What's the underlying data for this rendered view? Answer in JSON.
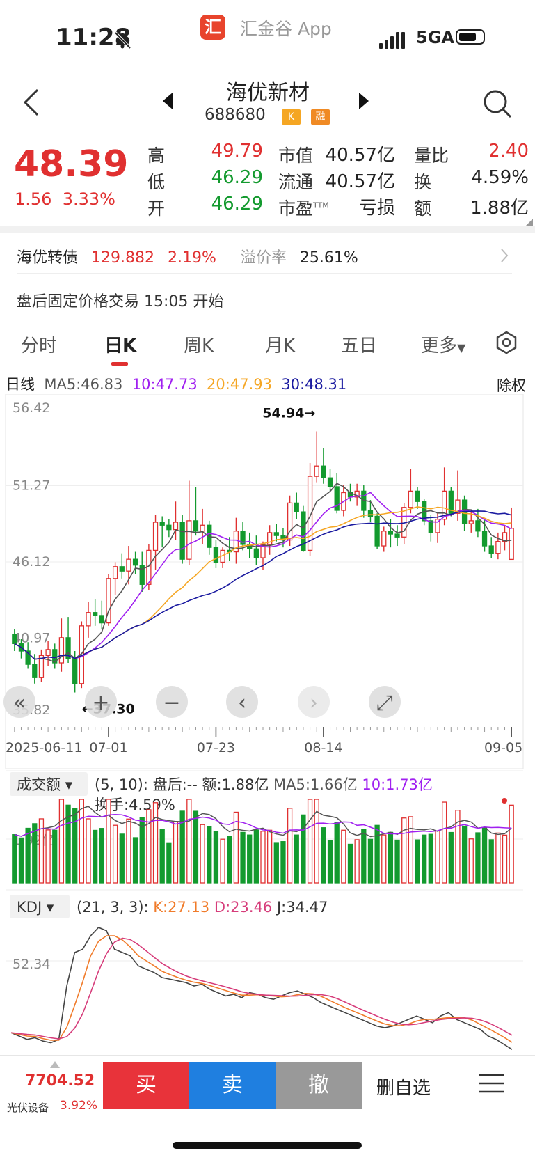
{
  "status": {
    "time": "11:28",
    "app_name": "汇金谷 App",
    "app_logo": "汇",
    "network": "5GA"
  },
  "header": {
    "name": "海优新材",
    "code": "688680",
    "tag_k": "K",
    "tag_rong": "融"
  },
  "quote": {
    "price": "48.39",
    "change": "1.56",
    "change_pct": "3.33%",
    "fields": [
      {
        "label": "高",
        "value": "49.79",
        "color": "red"
      },
      {
        "label": "低",
        "value": "46.29",
        "color": "green"
      },
      {
        "label": "开",
        "value": "46.29",
        "color": "green"
      },
      {
        "label": "市值",
        "value": "40.57亿",
        "color": "dark"
      },
      {
        "label": "流通",
        "value": "40.57亿",
        "color": "dark"
      },
      {
        "label": "市盈",
        "sup": "TTM",
        "value": "亏损",
        "color": "dark"
      },
      {
        "label": "量比",
        "value": "2.40",
        "color": "red"
      },
      {
        "label": "换",
        "value": "4.59%",
        "color": "dark"
      },
      {
        "label": "额",
        "value": "1.88亿",
        "color": "dark"
      }
    ]
  },
  "bond": {
    "name": "海优转债",
    "price": "129.882",
    "pct": "2.19%",
    "premium_label": "溢价率",
    "premium": "25.61%"
  },
  "after_hours": "盘后固定价格交易 15:05 开始",
  "tabs": [
    "分时",
    "日K",
    "周K",
    "月K",
    "五日",
    "更多"
  ],
  "ma": {
    "label": "日线",
    "ma5": "MA5:46.83",
    "ma10": "10:47.73",
    "ma20": "20:47.93",
    "ma30": "30:48.31",
    "adjust": "除权"
  },
  "colors": {
    "up": "#e03030",
    "down": "#139a2e",
    "ma5": "#555555",
    "ma10": "#a020f0",
    "ma20": "#f5a623",
    "ma30": "#1a1aa0"
  },
  "chart_data": [
    {
      "type": "candlestick",
      "title": "日K",
      "y_ticks": [
        "56.42",
        "51.27",
        "46.12",
        "40.97",
        "35.82"
      ],
      "ylim": [
        35.82,
        56.42
      ],
      "x_ticks": [
        "2025-06-11",
        "07-01",
        "07-23",
        "08-14",
        "09-05"
      ],
      "max_label": "54.94→",
      "min_label": "←37.30",
      "ohlc": [
        [
          41.2,
          41.6,
          40.1,
          40.6
        ],
        [
          40.6,
          40.9,
          39.6,
          40.1
        ],
        [
          40.1,
          40.7,
          38.9,
          39.2
        ],
        [
          39.2,
          39.9,
          37.9,
          38.3
        ],
        [
          38.3,
          40.2,
          38.0,
          39.8
        ],
        [
          39.8,
          40.8,
          39.1,
          40.2
        ],
        [
          40.2,
          40.6,
          38.9,
          39.3
        ],
        [
          39.3,
          42.3,
          38.7,
          41.0
        ],
        [
          41.0,
          42.4,
          39.3,
          39.6
        ],
        [
          39.6,
          40.1,
          37.3,
          37.9
        ],
        [
          37.9,
          42.1,
          37.6,
          41.8
        ],
        [
          41.8,
          43.4,
          41.0,
          42.7
        ],
        [
          42.7,
          43.6,
          41.8,
          42.5
        ],
        [
          42.5,
          43.5,
          41.6,
          42.0
        ],
        [
          42.0,
          45.3,
          41.8,
          45.0
        ],
        [
          45.0,
          46.1,
          43.9,
          45.8
        ],
        [
          45.8,
          46.7,
          45.0,
          45.5
        ],
        [
          45.5,
          47.2,
          44.6,
          46.3
        ],
        [
          46.3,
          46.8,
          45.3,
          45.9
        ],
        [
          45.9,
          46.8,
          44.1,
          44.6
        ],
        [
          44.6,
          47.3,
          44.2,
          46.9
        ],
        [
          46.9,
          49.3,
          45.6,
          48.8
        ],
        [
          48.8,
          49.2,
          47.1,
          48.6
        ],
        [
          48.6,
          49.0,
          47.8,
          48.3
        ],
        [
          48.3,
          50.2,
          47.6,
          48.8
        ],
        [
          48.8,
          49.3,
          46.0,
          46.3
        ],
        [
          46.3,
          51.6,
          45.9,
          48.9
        ],
        [
          48.9,
          51.2,
          47.9,
          48.2
        ],
        [
          48.2,
          49.7,
          47.3,
          48.6
        ],
        [
          48.6,
          48.9,
          46.6,
          47.1
        ],
        [
          47.1,
          47.6,
          45.7,
          46.1
        ],
        [
          46.1,
          47.1,
          45.7,
          46.9
        ],
        [
          46.9,
          47.8,
          46.2,
          46.8
        ],
        [
          46.8,
          49.1,
          46.0,
          48.2
        ],
        [
          48.2,
          48.8,
          46.9,
          47.3
        ],
        [
          47.3,
          48.1,
          46.4,
          47.0
        ],
        [
          47.0,
          47.9,
          45.9,
          46.4
        ],
        [
          46.4,
          47.5,
          45.6,
          47.3
        ],
        [
          47.3,
          48.6,
          46.6,
          48.1
        ],
        [
          48.1,
          48.7,
          47.5,
          47.9
        ],
        [
          47.9,
          48.4,
          47.1,
          47.6
        ],
        [
          47.6,
          50.6,
          47.2,
          50.1
        ],
        [
          50.1,
          50.8,
          49.0,
          49.5
        ],
        [
          49.5,
          49.9,
          46.8,
          46.9
        ],
        [
          46.9,
          52.8,
          46.5,
          51.9
        ],
        [
          51.9,
          54.94,
          51.5,
          52.6
        ],
        [
          52.6,
          53.8,
          51.4,
          51.8
        ],
        [
          51.8,
          52.4,
          50.9,
          51.2
        ],
        [
          51.2,
          52.1,
          49.4,
          49.6
        ],
        [
          49.6,
          51.3,
          49.2,
          50.8
        ],
        [
          50.8,
          51.4,
          50.2,
          50.5
        ],
        [
          50.5,
          51.4,
          49.9,
          50.9
        ],
        [
          50.9,
          51.3,
          49.1,
          49.6
        ],
        [
          49.6,
          50.3,
          48.8,
          49.2
        ],
        [
          49.2,
          49.4,
          47.0,
          47.2
        ],
        [
          47.2,
          48.5,
          46.8,
          48.2
        ],
        [
          48.2,
          49.0,
          47.1,
          48.0
        ],
        [
          48.0,
          48.6,
          47.2,
          47.8
        ],
        [
          47.8,
          50.1,
          47.3,
          49.8
        ],
        [
          49.8,
          52.4,
          49.4,
          50.9
        ],
        [
          50.9,
          51.2,
          49.7,
          50.2
        ],
        [
          50.2,
          50.4,
          48.6,
          48.9
        ],
        [
          48.9,
          49.3,
          47.5,
          48.1
        ],
        [
          48.1,
          49.4,
          47.4,
          49.0
        ],
        [
          49.0,
          52.5,
          48.6,
          50.9
        ],
        [
          50.9,
          51.2,
          49.2,
          49.4
        ],
        [
          49.4,
          52.3,
          48.9,
          50.3
        ],
        [
          50.3,
          50.6,
          48.2,
          48.7
        ],
        [
          48.7,
          49.6,
          48.1,
          48.9
        ],
        [
          48.9,
          49.7,
          47.8,
          48.2
        ],
        [
          48.2,
          49.0,
          46.8,
          47.2
        ],
        [
          47.2,
          47.8,
          46.4,
          46.7
        ],
        [
          46.7,
          48.1,
          46.3,
          47.5
        ],
        [
          47.5,
          48.6,
          46.9,
          48.1
        ],
        [
          46.29,
          49.79,
          46.29,
          48.39
        ]
      ]
    },
    {
      "type": "bar",
      "title": "成交额",
      "params": "(5, 10):",
      "after": "盘后:--",
      "amount": "额:1.88亿",
      "ma5": "MA5:1.66亿",
      "ma10": "10:1.73亿",
      "turnover": "换手:4.59%",
      "y_tick": "1.92亿"
    },
    {
      "type": "line",
      "title": "KDJ",
      "params": "(21, 3, 3):",
      "k": "K:27.13",
      "d": "D:23.46",
      "j": "J:34.47",
      "y_tick": "52.34"
    }
  ],
  "bottom": {
    "index_value": "7704.52",
    "index_name": "光伏设备",
    "index_pct": "3.92%",
    "buy": "买",
    "sell": "卖",
    "cancel": "撤",
    "watch": "删自选"
  }
}
